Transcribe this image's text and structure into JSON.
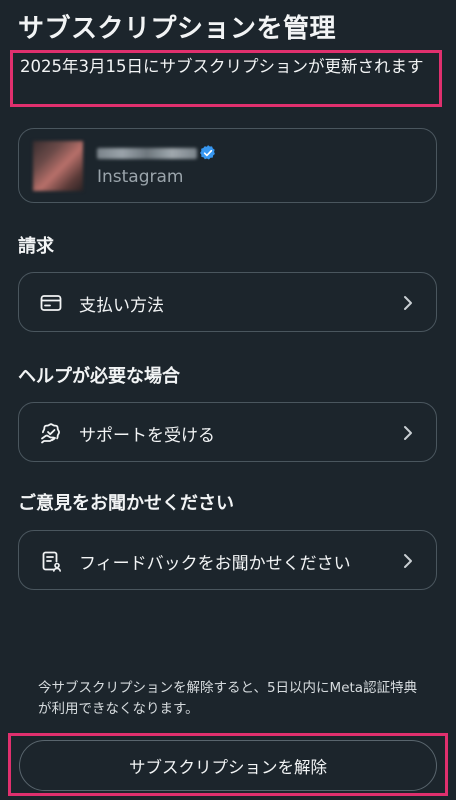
{
  "header": {
    "title": "サブスクリプションを管理",
    "renewal_notice": "2025年3月15日にサブスクリプションが更新されます"
  },
  "account": {
    "app_name": "Instagram",
    "avatar_icon": "blurred-profile-photo",
    "verified_icon": "verified-badge-icon",
    "verified_color": "#3797f0"
  },
  "sections": {
    "billing": {
      "title": "請求",
      "item_label": "支払い方法",
      "item_icon": "credit-card-icon"
    },
    "help": {
      "title": "ヘルプが必要な場合",
      "item_label": "サポートを受ける",
      "item_icon": "support-icon"
    },
    "feedback": {
      "title": "ご意見をお聞かせください",
      "item_label": "フィードバックをお聞かせください",
      "item_icon": "feedback-form-icon"
    }
  },
  "footer": {
    "notice": "今サブスクリプションを解除すると、5日以内にMeta認証特典が利用できなくなります。",
    "cancel_label": "サブスクリプションを解除"
  },
  "colors": {
    "background": "#1c252c",
    "highlight": "#e0306e",
    "card_border": "#4a565e"
  }
}
